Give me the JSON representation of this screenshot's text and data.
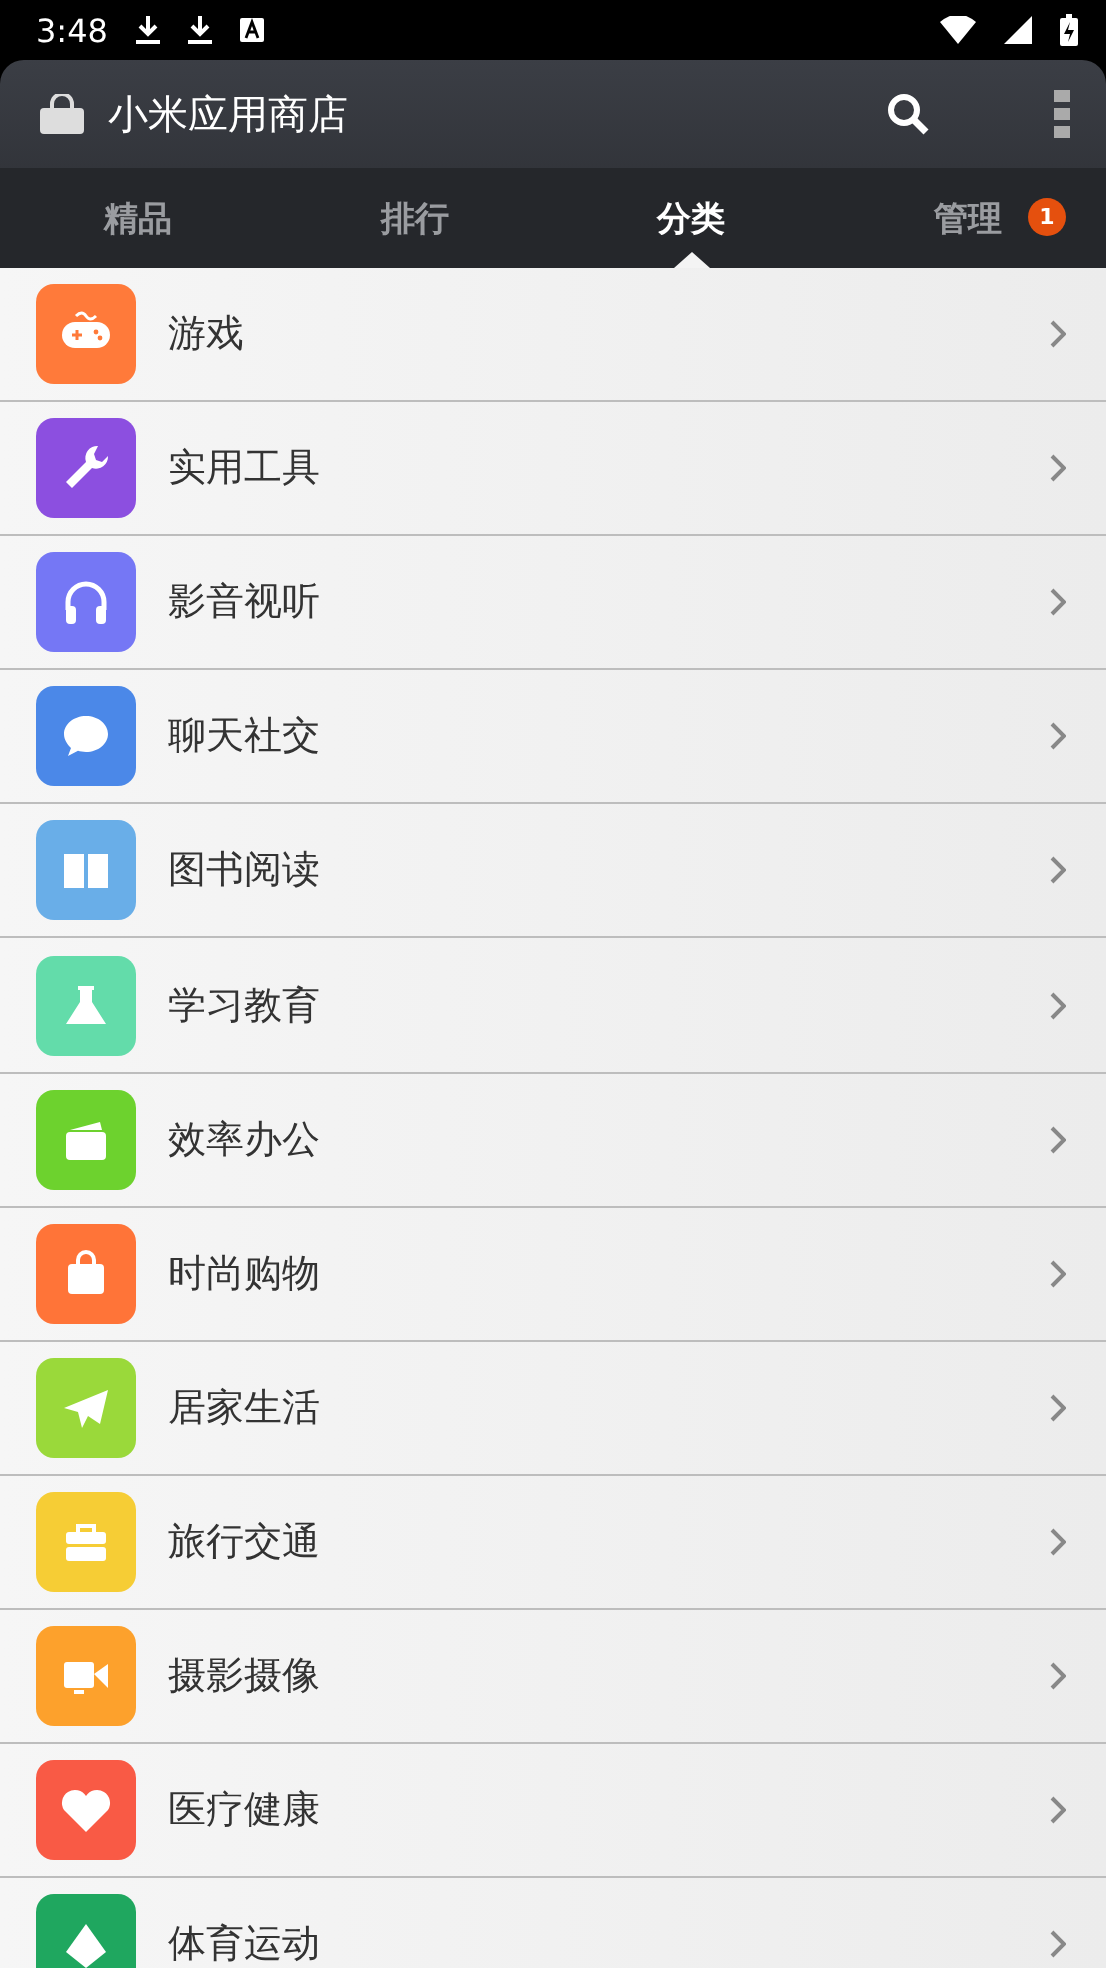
{
  "status_bar": {
    "time": "3:48"
  },
  "app_bar": {
    "title": "小米应用商店"
  },
  "tabs": [
    {
      "label": "精品",
      "selected": false
    },
    {
      "label": "排行",
      "selected": false
    },
    {
      "label": "分类",
      "selected": true
    },
    {
      "label": "管理",
      "selected": false,
      "badge": "1"
    }
  ],
  "categories": [
    {
      "name": "游戏",
      "kind": "gamepad",
      "color": "#ff7a3a"
    },
    {
      "name": "实用工具",
      "kind": "wrench",
      "color": "#8c4fe0"
    },
    {
      "name": "影音视听",
      "kind": "headphones",
      "color": "#7577f5"
    },
    {
      "name": "聊天社交",
      "kind": "chat",
      "color": "#4b88e8"
    },
    {
      "name": "图书阅读",
      "kind": "book",
      "color": "#69aee8"
    },
    {
      "name": "学习教育",
      "kind": "flask",
      "color": "#63dcaa"
    },
    {
      "name": "效率办公",
      "kind": "wallet",
      "color": "#6dd22e"
    },
    {
      "name": "时尚购物",
      "kind": "bag",
      "color": "#ff7438"
    },
    {
      "name": "居家生活",
      "kind": "plane",
      "color": "#9ad93a"
    },
    {
      "name": "旅行交通",
      "kind": "briefcase",
      "color": "#f6cd35"
    },
    {
      "name": "摄影摄像",
      "kind": "camera",
      "color": "#fda12c"
    },
    {
      "name": "医疗健康",
      "kind": "heart",
      "color": "#f95a45"
    },
    {
      "name": "体育运动",
      "kind": "sports",
      "color": "#1fa75f"
    }
  ]
}
